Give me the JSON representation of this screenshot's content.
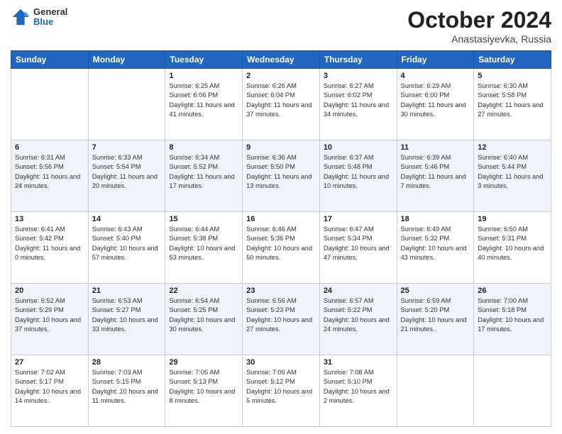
{
  "header": {
    "logo_general": "General",
    "logo_blue": "Blue",
    "title": "October 2024",
    "location": "Anastasiyevka, Russia"
  },
  "weekdays": [
    "Sunday",
    "Monday",
    "Tuesday",
    "Wednesday",
    "Thursday",
    "Friday",
    "Saturday"
  ],
  "weeks": [
    [
      {
        "day": "",
        "info": ""
      },
      {
        "day": "",
        "info": ""
      },
      {
        "day": "1",
        "info": "Sunrise: 6:25 AM\nSunset: 6:06 PM\nDaylight: 11 hours and 41 minutes."
      },
      {
        "day": "2",
        "info": "Sunrise: 6:26 AM\nSunset: 6:04 PM\nDaylight: 11 hours and 37 minutes."
      },
      {
        "day": "3",
        "info": "Sunrise: 6:27 AM\nSunset: 6:02 PM\nDaylight: 11 hours and 34 minutes."
      },
      {
        "day": "4",
        "info": "Sunrise: 6:29 AM\nSunset: 6:00 PM\nDaylight: 11 hours and 30 minutes."
      },
      {
        "day": "5",
        "info": "Sunrise: 6:30 AM\nSunset: 5:58 PM\nDaylight: 11 hours and 27 minutes."
      }
    ],
    [
      {
        "day": "6",
        "info": "Sunrise: 6:31 AM\nSunset: 5:56 PM\nDaylight: 11 hours and 24 minutes."
      },
      {
        "day": "7",
        "info": "Sunrise: 6:33 AM\nSunset: 5:54 PM\nDaylight: 11 hours and 20 minutes."
      },
      {
        "day": "8",
        "info": "Sunrise: 6:34 AM\nSunset: 5:52 PM\nDaylight: 11 hours and 17 minutes."
      },
      {
        "day": "9",
        "info": "Sunrise: 6:36 AM\nSunset: 5:50 PM\nDaylight: 11 hours and 13 minutes."
      },
      {
        "day": "10",
        "info": "Sunrise: 6:37 AM\nSunset: 5:48 PM\nDaylight: 11 hours and 10 minutes."
      },
      {
        "day": "11",
        "info": "Sunrise: 6:39 AM\nSunset: 5:46 PM\nDaylight: 11 hours and 7 minutes."
      },
      {
        "day": "12",
        "info": "Sunrise: 6:40 AM\nSunset: 5:44 PM\nDaylight: 11 hours and 3 minutes."
      }
    ],
    [
      {
        "day": "13",
        "info": "Sunrise: 6:41 AM\nSunset: 5:42 PM\nDaylight: 11 hours and 0 minutes."
      },
      {
        "day": "14",
        "info": "Sunrise: 6:43 AM\nSunset: 5:40 PM\nDaylight: 10 hours and 57 minutes."
      },
      {
        "day": "15",
        "info": "Sunrise: 6:44 AM\nSunset: 5:38 PM\nDaylight: 10 hours and 53 minutes."
      },
      {
        "day": "16",
        "info": "Sunrise: 6:46 AM\nSunset: 5:36 PM\nDaylight: 10 hours and 50 minutes."
      },
      {
        "day": "17",
        "info": "Sunrise: 6:47 AM\nSunset: 5:34 PM\nDaylight: 10 hours and 47 minutes."
      },
      {
        "day": "18",
        "info": "Sunrise: 6:49 AM\nSunset: 5:32 PM\nDaylight: 10 hours and 43 minutes."
      },
      {
        "day": "19",
        "info": "Sunrise: 6:50 AM\nSunset: 5:31 PM\nDaylight: 10 hours and 40 minutes."
      }
    ],
    [
      {
        "day": "20",
        "info": "Sunrise: 6:52 AM\nSunset: 5:29 PM\nDaylight: 10 hours and 37 minutes."
      },
      {
        "day": "21",
        "info": "Sunrise: 6:53 AM\nSunset: 5:27 PM\nDaylight: 10 hours and 33 minutes."
      },
      {
        "day": "22",
        "info": "Sunrise: 6:54 AM\nSunset: 5:25 PM\nDaylight: 10 hours and 30 minutes."
      },
      {
        "day": "23",
        "info": "Sunrise: 6:56 AM\nSunset: 5:23 PM\nDaylight: 10 hours and 27 minutes."
      },
      {
        "day": "24",
        "info": "Sunrise: 6:57 AM\nSunset: 5:22 PM\nDaylight: 10 hours and 24 minutes."
      },
      {
        "day": "25",
        "info": "Sunrise: 6:59 AM\nSunset: 5:20 PM\nDaylight: 10 hours and 21 minutes."
      },
      {
        "day": "26",
        "info": "Sunrise: 7:00 AM\nSunset: 5:18 PM\nDaylight: 10 hours and 17 minutes."
      }
    ],
    [
      {
        "day": "27",
        "info": "Sunrise: 7:02 AM\nSunset: 5:17 PM\nDaylight: 10 hours and 14 minutes."
      },
      {
        "day": "28",
        "info": "Sunrise: 7:03 AM\nSunset: 5:15 PM\nDaylight: 10 hours and 11 minutes."
      },
      {
        "day": "29",
        "info": "Sunrise: 7:05 AM\nSunset: 5:13 PM\nDaylight: 10 hours and 8 minutes."
      },
      {
        "day": "30",
        "info": "Sunrise: 7:06 AM\nSunset: 5:12 PM\nDaylight: 10 hours and 5 minutes."
      },
      {
        "day": "31",
        "info": "Sunrise: 7:08 AM\nSunset: 5:10 PM\nDaylight: 10 hours and 2 minutes."
      },
      {
        "day": "",
        "info": ""
      },
      {
        "day": "",
        "info": ""
      }
    ]
  ]
}
